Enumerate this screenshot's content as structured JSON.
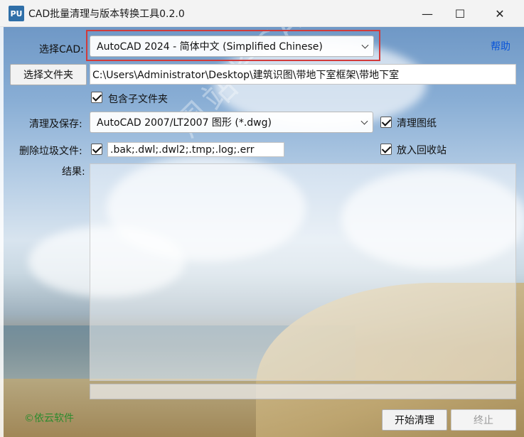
{
  "window": {
    "app_icon_text": "PU",
    "title": "CAD批量清理与版本转换工具0.2.0",
    "minimize_glyph": "—",
    "maximize_glyph": "☐",
    "close_glyph": "✕"
  },
  "cad": {
    "label": "选择CAD:",
    "selected": "AutoCAD 2024 - 简体中文 (Simplified Chinese)"
  },
  "help_link": "帮助",
  "folder": {
    "button_label": "选择文件夹",
    "path": "C:\\Users\\Administrator\\Desktop\\建筑识图\\带地下室框架\\带地下室",
    "include_subfolders_label": "包含子文件夹",
    "include_subfolders_checked": true
  },
  "save": {
    "label": "清理及保存:",
    "selected": "AutoCAD 2007/LT2007 图形 (*.dwg)",
    "purge_label": "清理图纸",
    "purge_checked": true
  },
  "junk": {
    "label": "删除垃圾文件:",
    "checked": true,
    "extensions": ".bak;.dwl;.dwl2;.tmp;.log;.err",
    "recycle_label": "放入回收站",
    "recycle_checked": true
  },
  "results": {
    "label": "结果:"
  },
  "actions": {
    "start_label": "开始清理",
    "stop_label": "终止"
  },
  "footer": "©依云软件",
  "watermark": "周站长CAD zzzcad.com",
  "colors": {
    "highlight": "#d23a3a",
    "link": "#0a55d8",
    "footer": "#2e8b2e"
  }
}
